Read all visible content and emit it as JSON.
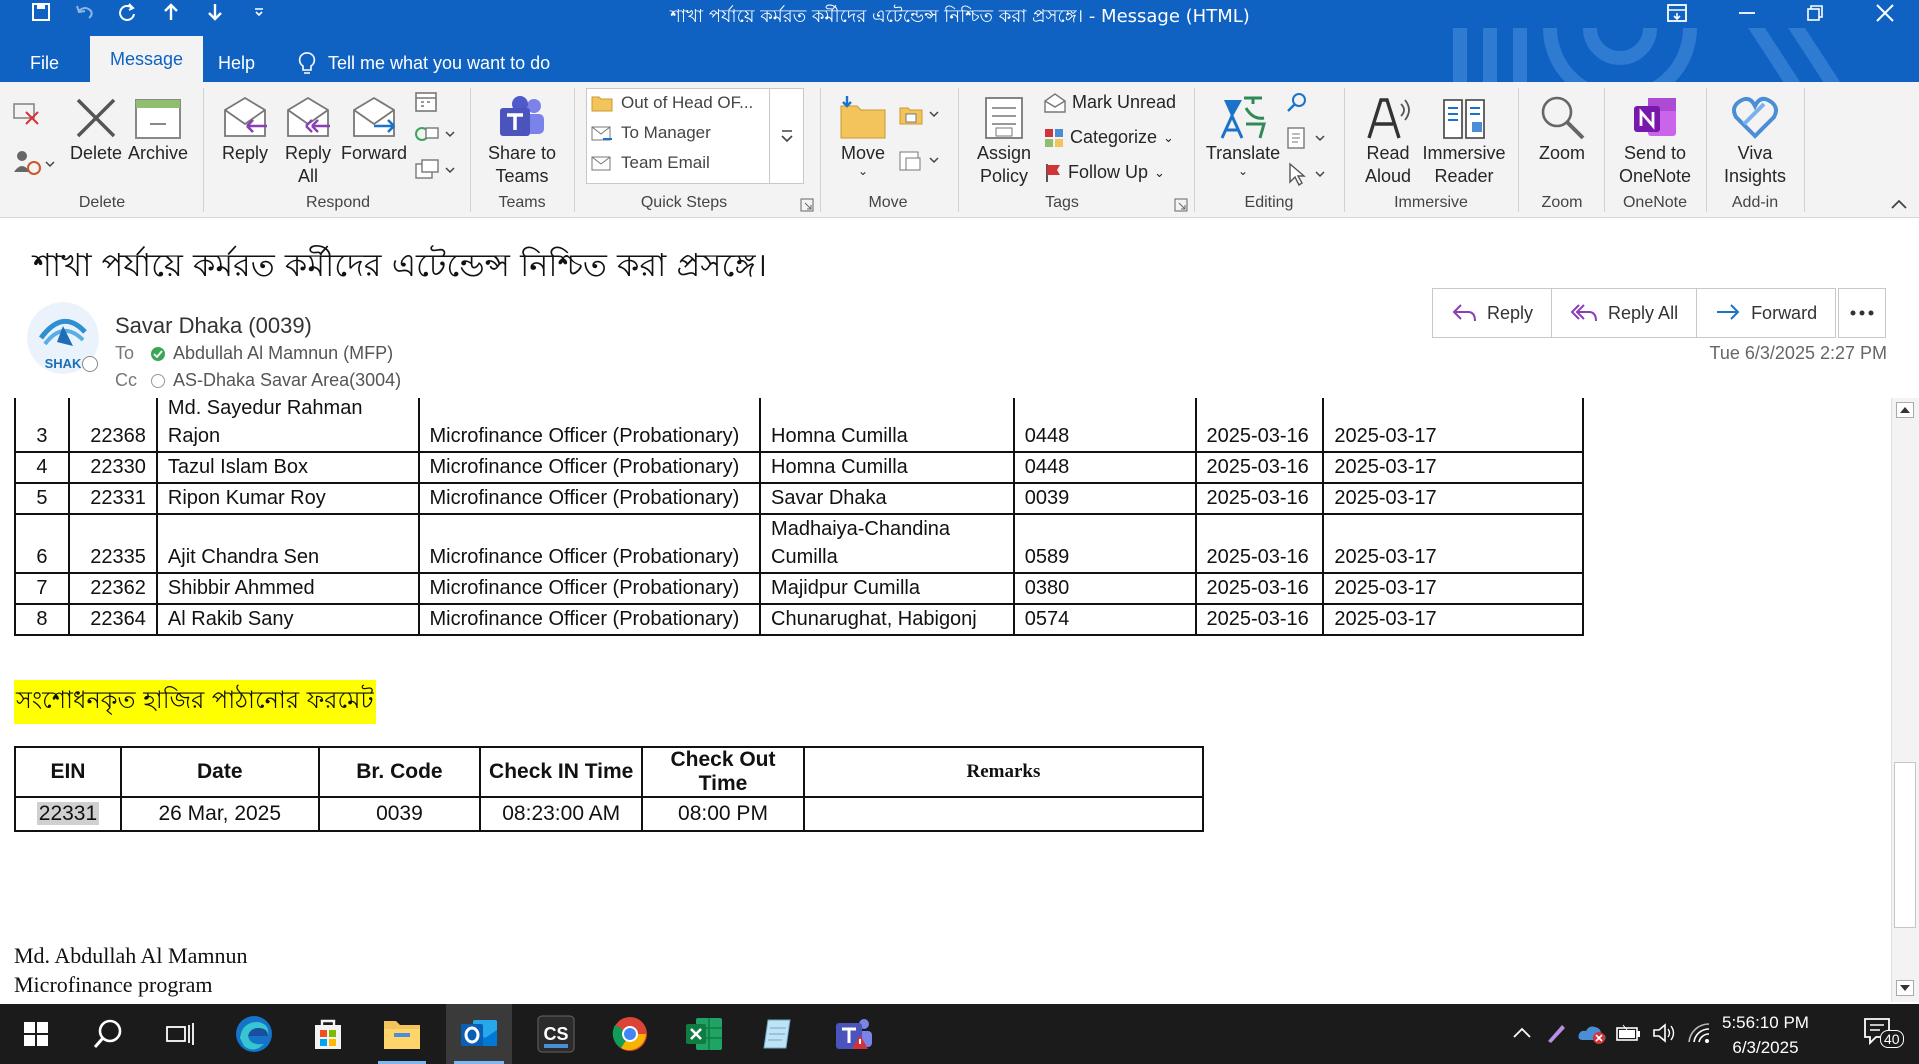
{
  "window": {
    "title": "শাখা পর্যায়ে কর্মরত কর্মীদের এটেন্ডেন্স নিশ্চিত করা প্রসঙ্গে।  -  Message (HTML)"
  },
  "tabs": [
    {
      "label": "File"
    },
    {
      "label": "Message"
    },
    {
      "label": "Help"
    }
  ],
  "tell_me": "Tell me what you want to do",
  "ribbon": {
    "groups": {
      "delete": "Delete",
      "respond": "Respond",
      "teams": "Teams",
      "quick_steps": "Quick Steps",
      "move": "Move",
      "tags": "Tags",
      "editing": "Editing",
      "immersive": "Immersive",
      "zoom": "Zoom",
      "onenote": "OneNote",
      "addin": "Add-in"
    },
    "buttons": {
      "delete": "Delete",
      "archive": "Archive",
      "reply": "Reply",
      "reply_all_1": "Reply",
      "reply_all_2": "All",
      "forward": "Forward",
      "share_1": "Share to",
      "share_2": "Teams",
      "move": "Move",
      "assign_1": "Assign",
      "assign_2": "Policy",
      "mark_unread": "Mark Unread",
      "categorize": "Categorize",
      "follow_up": "Follow Up",
      "translate": "Translate",
      "read_1": "Read",
      "read_2": "Aloud",
      "immersive_1": "Immersive",
      "immersive_2": "Reader",
      "zoom": "Zoom",
      "onenote_1": "Send to",
      "onenote_2": "OneNote",
      "viva_1": "Viva",
      "viva_2": "Insights"
    },
    "quick_steps": [
      "Out of Head OF...",
      "To Manager",
      "Team Email"
    ]
  },
  "message": {
    "subject": "শাখা পর্যায়ে কর্মরত কর্মীদের এটেন্ডেন্স নিশ্চিত করা প্রসঙ্গে।",
    "sender": "Savar Dhaka (0039)",
    "avatar_text": "SHAK",
    "to_label": "To",
    "to": "Abdullah Al Mamnun (MFP)",
    "cc_label": "Cc",
    "cc": "AS-Dhaka Savar Area(3004)",
    "datetime": "Tue 6/3/2025 2:27 PM",
    "actions": {
      "reply": "Reply",
      "reply_all": "Reply All",
      "forward": "Forward"
    }
  },
  "staff_table": {
    "rows": [
      {
        "sl": "3",
        "ein": "22368",
        "name": "Md. Sayedur Rahman Rajon",
        "designation": "Microfinance Officer (Probationary)",
        "branch": "Homna Cumilla",
        "code": "0448",
        "from": "2025-03-16",
        "to": "2025-03-17"
      },
      {
        "sl": "4",
        "ein": "22330",
        "name": "Tazul Islam Box",
        "designation": "Microfinance Officer (Probationary)",
        "branch": "Homna Cumilla",
        "code": "0448",
        "from": "2025-03-16",
        "to": "2025-03-17"
      },
      {
        "sl": "5",
        "ein": "22331",
        "name": "Ripon Kumar Roy",
        "designation": "Microfinance Officer (Probationary)",
        "branch": "Savar  Dhaka",
        "code": "0039",
        "from": "2025-03-16",
        "to": "2025-03-17"
      },
      {
        "sl": "6",
        "ein": "22335",
        "name": "Ajit Chandra Sen",
        "designation": "Microfinance Officer (Probationary)",
        "branch": "Madhaiya-Chandina Cumilla",
        "code": "0589",
        "from": "2025-03-16",
        "to": "2025-03-17"
      },
      {
        "sl": "7",
        "ein": "22362",
        "name": "Shibbir  Ahmmed",
        "designation": "Microfinance Officer (Probationary)",
        "branch": "Majidpur Cumilla",
        "code": "0380",
        "from": "2025-03-16",
        "to": "2025-03-17"
      },
      {
        "sl": "8",
        "ein": "22364",
        "name": "Al Rakib  Sany",
        "designation": "Microfinance Officer (Probationary)",
        "branch": "Chunarughat, Habigonj",
        "code": "0574",
        "from": "2025-03-16",
        "to": "2025-03-17"
      }
    ]
  },
  "format_heading": "সংশোধনকৃত  হাজির  পাঠানোর  ফরমেট",
  "format_table": {
    "headers": [
      "EIN",
      "Date",
      "Br. Code",
      "Check IN Time",
      "Check Out Time",
      "Remarks"
    ],
    "row": [
      "22331",
      "26 Mar, 2025",
      "0039",
      "08:23:00 AM",
      "08:00 PM",
      ""
    ]
  },
  "signature": [
    "Md. Abdullah Al Mamnun",
    "Microfinance program"
  ],
  "taskbar": {
    "time": "5:56:10 PM",
    "date": "6/3/2025",
    "notifications": "40"
  },
  "colors": {
    "accent": "#0f62c2",
    "ribbon": "#f3f3f3",
    "highlight": "#ffff00"
  }
}
